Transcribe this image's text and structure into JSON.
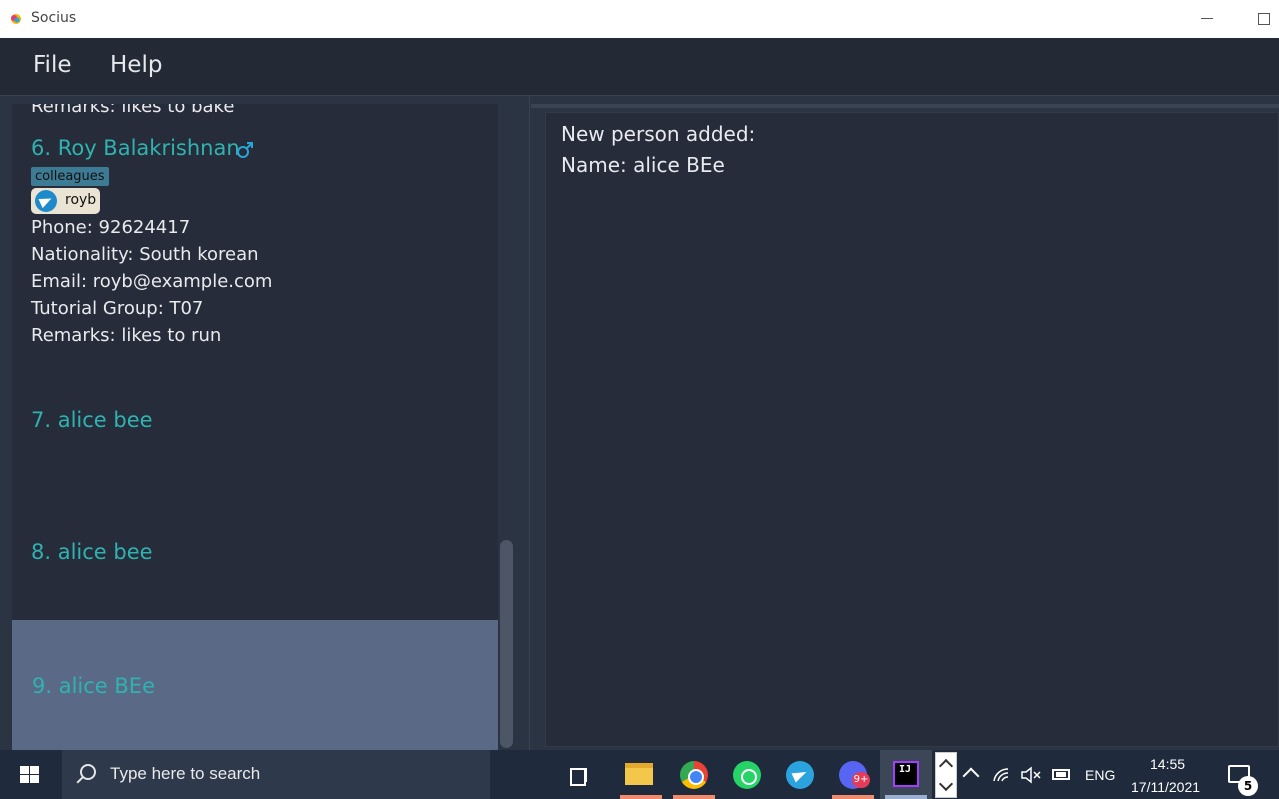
{
  "window": {
    "title": "Socius"
  },
  "menu": {
    "file": "File",
    "help": "Help"
  },
  "list": {
    "prev_remarks": "Remarks: likes to bake",
    "card6": {
      "index_name": "6.  Roy Balakrishnan",
      "gender_icon": "male-gender-icon",
      "tag": "colleagues",
      "telegram": "royb",
      "phone": "Phone: 92624417",
      "nationality": "Nationality: South korean",
      "email": "Email: royb@example.com",
      "tutorial": "Tutorial Group: T07",
      "remarks": "Remarks: likes to run"
    },
    "card7": {
      "index_name": "7.  alice bee"
    },
    "card8": {
      "index_name": "8.  alice  bee"
    },
    "card9": {
      "index_name": "9.  alice BEe"
    }
  },
  "result": {
    "line1": "New person added:",
    "line2": "Name: alice BEe"
  },
  "taskbar": {
    "search_placeholder": "Type here to search",
    "discord_badge": "9+",
    "language": "ENG",
    "time": "14:55",
    "date": "17/11/2021",
    "notification_count": "5"
  },
  "colors": {
    "accent_name": "#2fb3b0",
    "panel_bg": "#262c3a",
    "selected_bg": "#5a6a86",
    "tag_bg": "#3d7a93"
  }
}
